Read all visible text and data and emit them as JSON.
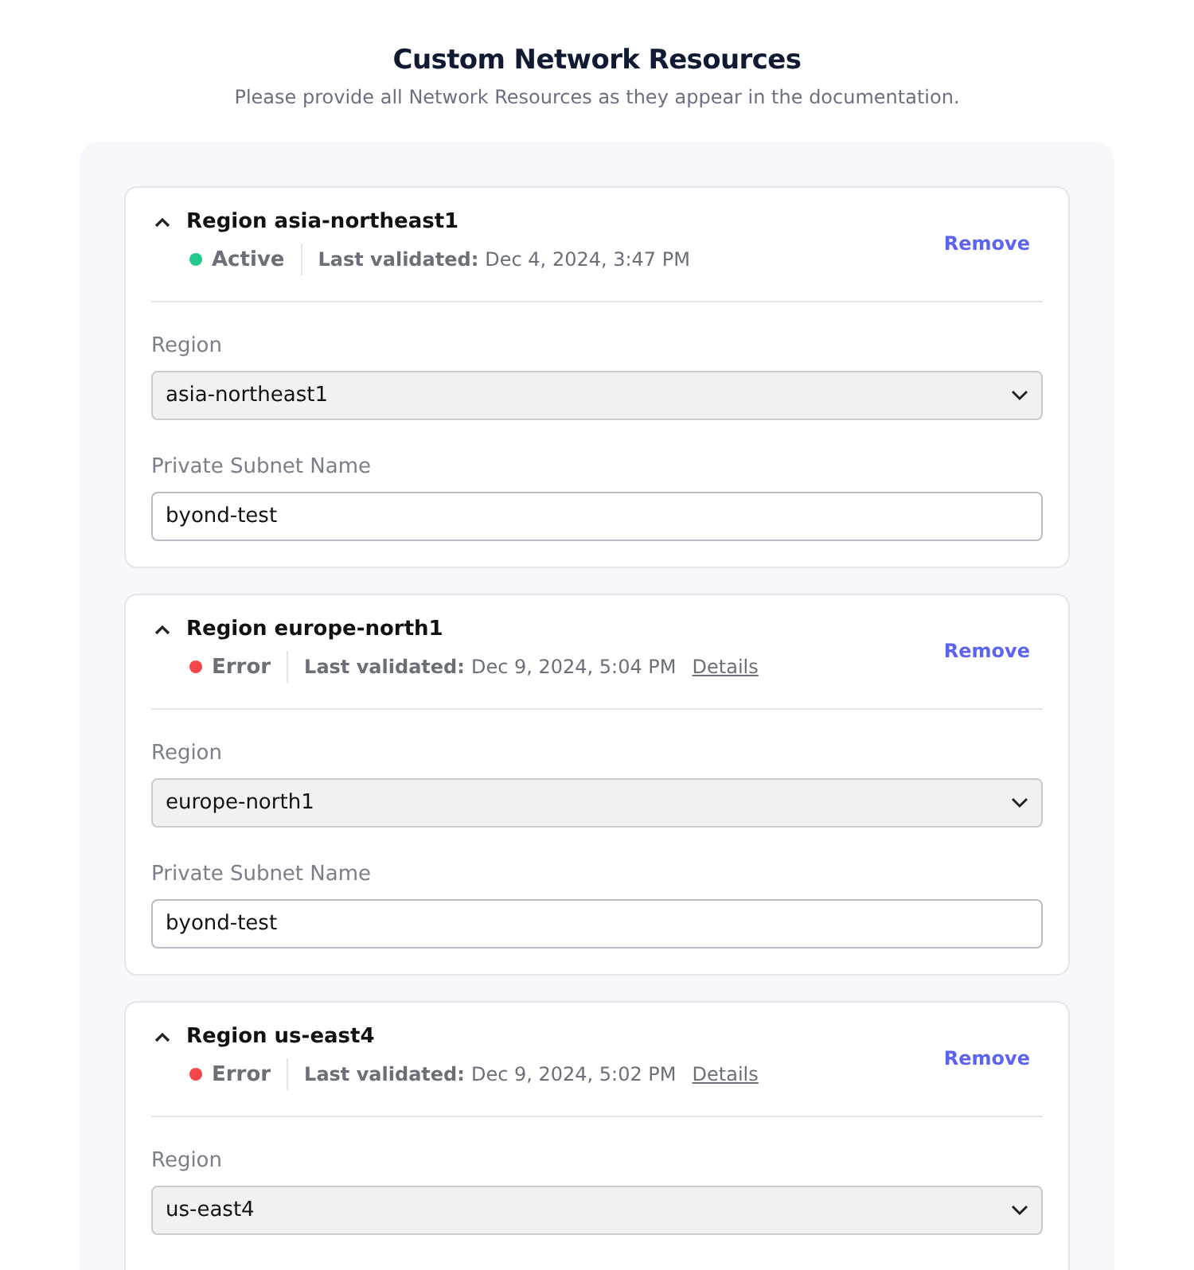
{
  "header": {
    "title": "Custom Network Resources",
    "subtitle": "Please provide all Network Resources as they appear in the documentation."
  },
  "resources": [
    {
      "title": "Region asia-northeast1",
      "expanded": true,
      "status": {
        "label": "Active",
        "color": "#22c98a"
      },
      "validated_label": "Last validated:",
      "validated_value": "Dec 4, 2024, 3:47 PM",
      "remove": "Remove",
      "fields": [
        {
          "kind": "select",
          "label": "Region",
          "value": "asia-northeast1"
        },
        {
          "kind": "text",
          "label": "Private Subnet Name",
          "value": "byond-test"
        }
      ]
    },
    {
      "title": "Region europe-north1",
      "expanded": true,
      "status": {
        "label": "Error",
        "color": "#f5474a"
      },
      "validated_label": "Last validated:",
      "validated_value": "Dec 9, 2024, 5:04 PM",
      "details_link": "Details",
      "remove": "Remove",
      "fields": [
        {
          "kind": "select",
          "label": "Region",
          "value": "europe-north1"
        },
        {
          "kind": "text",
          "label": "Private Subnet Name",
          "value": "byond-test"
        }
      ]
    },
    {
      "title": "Region us-east4",
      "expanded": true,
      "status": {
        "label": "Error",
        "color": "#f5474a"
      },
      "validated_label": "Last validated:",
      "validated_value": "Dec 9, 2024, 5:02 PM",
      "details_link": "Details",
      "remove": "Remove",
      "fields": [
        {
          "kind": "select",
          "label": "Region",
          "value": "us-east4"
        }
      ]
    }
  ]
}
